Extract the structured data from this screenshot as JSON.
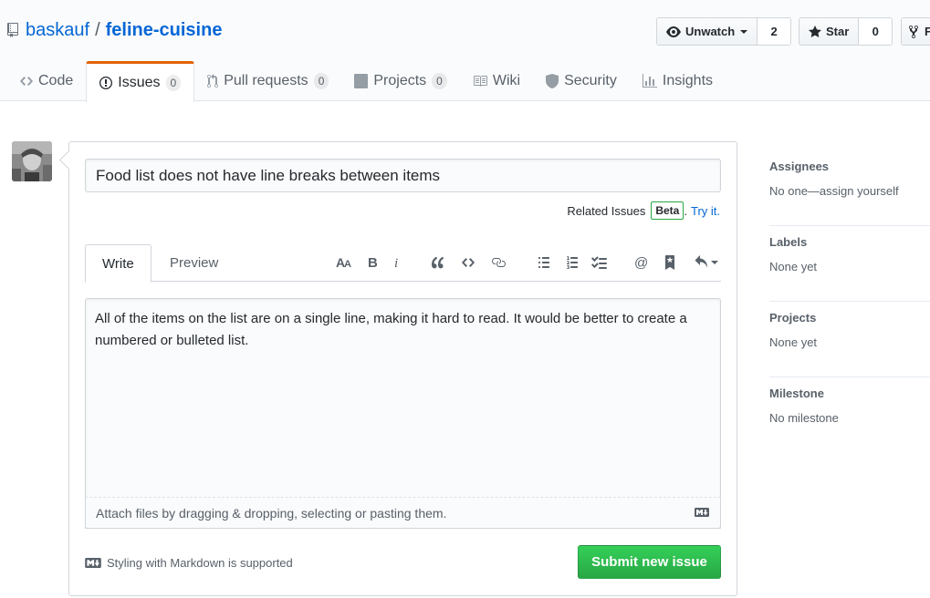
{
  "repo": {
    "owner": "baskauf",
    "separator": "/",
    "name": "feline-cuisine"
  },
  "actions": {
    "watch": {
      "label": "Unwatch",
      "count": "2"
    },
    "star": {
      "label": "Star",
      "count": "0"
    },
    "fork": {
      "label": "F"
    }
  },
  "nav": [
    {
      "label": "Code",
      "icon": "code-icon"
    },
    {
      "label": "Issues",
      "count": "0",
      "icon": "issue-opened-icon"
    },
    {
      "label": "Pull requests",
      "count": "0",
      "icon": "git-pull-request-icon"
    },
    {
      "label": "Projects",
      "count": "0",
      "icon": "project-icon"
    },
    {
      "label": "Wiki",
      "icon": "book-icon"
    },
    {
      "label": "Security",
      "icon": "shield-icon"
    },
    {
      "label": "Insights",
      "icon": "graph-icon"
    }
  ],
  "form": {
    "title_value": "Food list does not have line breaks between items",
    "related_label": "Related Issues",
    "beta_label": "Beta",
    "period": ".",
    "try_link": "Try it.",
    "tabs": {
      "write": "Write",
      "preview": "Preview"
    },
    "toolbar": [
      "text-size-icon",
      "bold-icon",
      "italic-icon",
      "quote-icon",
      "code-icon",
      "link-icon",
      "unordered-list-icon",
      "ordered-list-icon",
      "tasklist-icon",
      "mention-icon",
      "bookmark-icon",
      "reply-icon"
    ],
    "body_text": "All of the items on the list are on a single line, making it hard to read.  It would be better to create a numbered or bulleted list.",
    "attach_text": "Attach files by dragging & dropping, selecting or pasting them.",
    "markdown_note": "Styling with Markdown is supported",
    "submit_label": "Submit new issue"
  },
  "sidebar": [
    {
      "heading": "Assignees",
      "value": "No one—assign yourself"
    },
    {
      "heading": "Labels",
      "value": "None yet"
    },
    {
      "heading": "Projects",
      "value": "None yet"
    },
    {
      "heading": "Milestone",
      "value": "No milestone"
    }
  ],
  "colors": {
    "link": "#0366d6",
    "accent_tab": "#e36209",
    "submit": "#28a745"
  }
}
